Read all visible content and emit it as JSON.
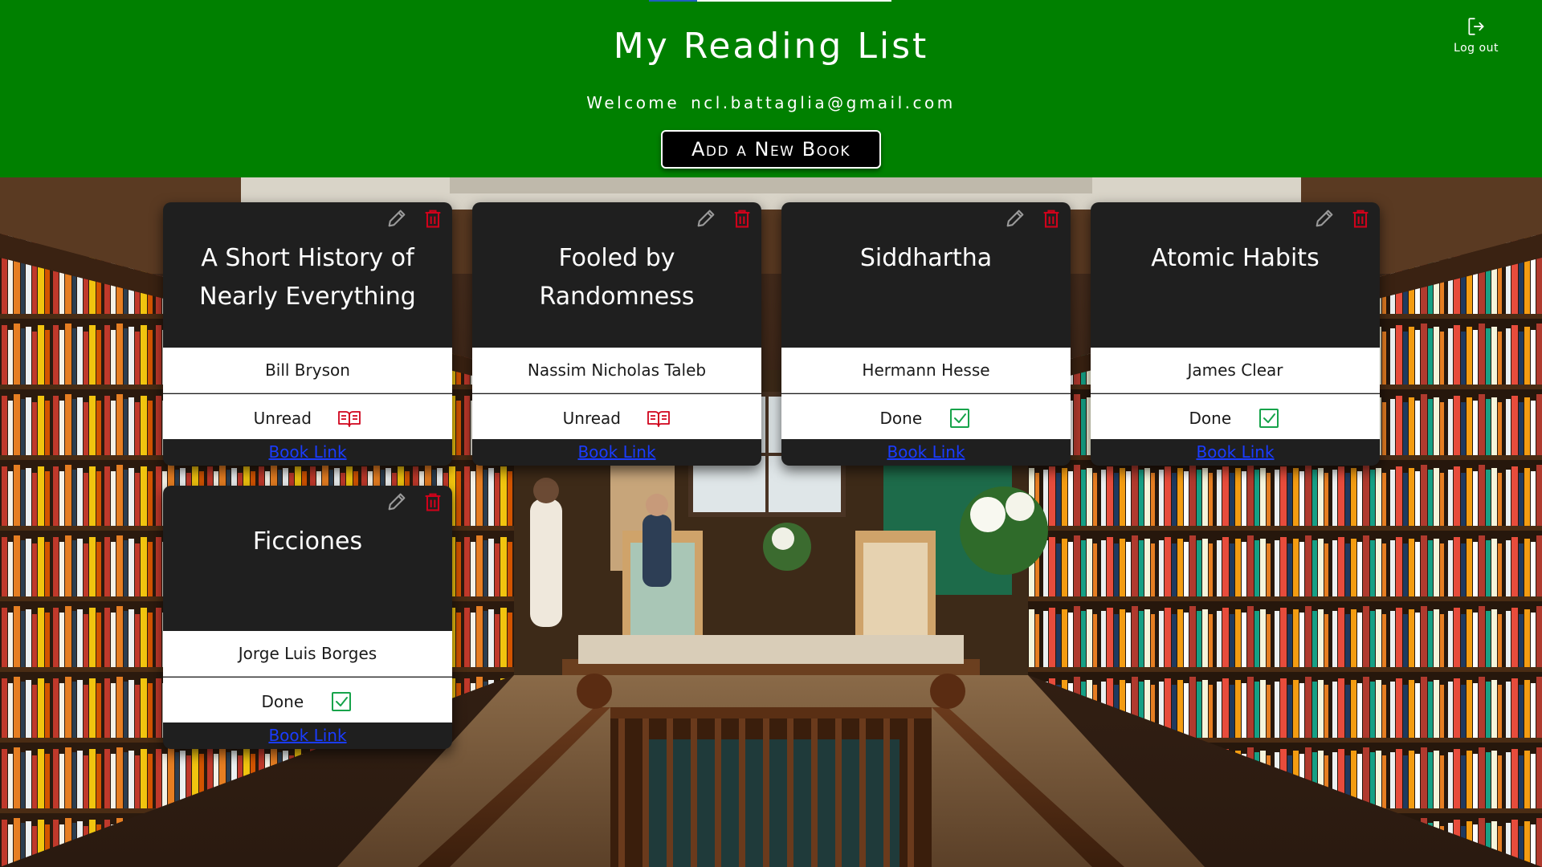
{
  "header": {
    "title": "My Reading List",
    "welcome_prefix": "Welcome",
    "user_email": "ncl.battaglia@gmail.com",
    "add_button_label": "Add a New Book",
    "logout_label": "Log out",
    "background_color": "#008000"
  },
  "status_colors": {
    "unread": "#d0021b",
    "done": "#16a34a",
    "delete": "#d0021b"
  },
  "books": [
    {
      "title": "A Short History of Nearly Everything",
      "author": "Bill Bryson",
      "status": "Unread",
      "status_icon": "open-book-icon",
      "link_label": "Book Link"
    },
    {
      "title": "Fooled by Randomness",
      "author": "Nassim Nicholas Taleb",
      "status": "Unread",
      "status_icon": "open-book-icon",
      "link_label": "Book Link"
    },
    {
      "title": "Siddhartha",
      "author": "Hermann Hesse",
      "status": "Done",
      "status_icon": "checkbox-checked-icon",
      "link_label": "Book Link"
    },
    {
      "title": "Atomic Habits",
      "author": "James Clear",
      "status": "Done",
      "status_icon": "checkbox-checked-icon",
      "link_label": "Book Link"
    },
    {
      "title": "Ficciones",
      "author": "Jorge Luis Borges",
      "status": "Done",
      "status_icon": "checkbox-checked-icon",
      "link_label": "Book Link"
    }
  ]
}
